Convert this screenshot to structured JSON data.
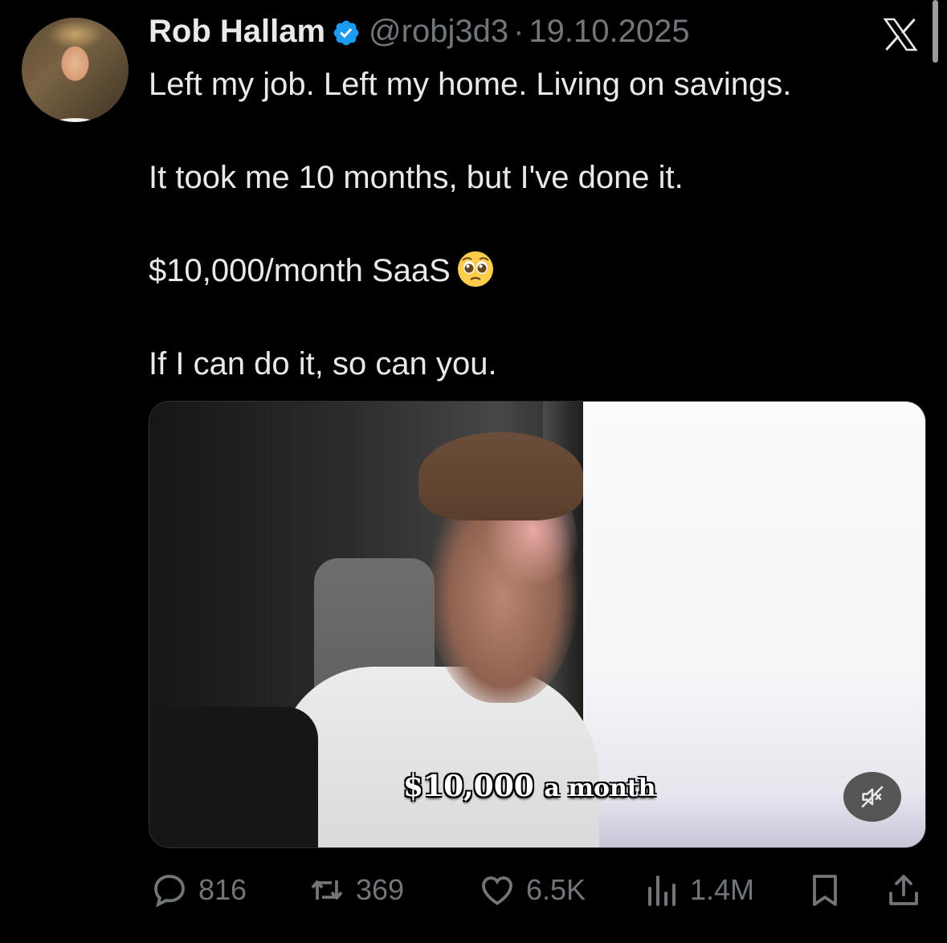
{
  "author": {
    "name": "Rob Hallam",
    "handle": "@robj3d3",
    "separator": "·",
    "date": "19.10.2025",
    "verified": true
  },
  "brand": {
    "logo_icon": "x-logo-icon"
  },
  "tweet": {
    "lines": [
      "Left my job. Left my home. Living on savings.",
      "It took me 10 months, but I've done it.",
      "$10,000/month SaaS",
      "If I can do it, so can you."
    ],
    "emoji": "pleading-face-emoji"
  },
  "media": {
    "type": "video",
    "caption_main": "$10,000",
    "caption_rest": "a month",
    "muted": true,
    "mute_icon": "speaker-muted-icon"
  },
  "actions": {
    "replies": "816",
    "reposts": "369",
    "likes": "6.5K",
    "views": "1.4M",
    "reply_icon": "speech-bubble-icon",
    "repost_icon": "repost-arrows-icon",
    "like_icon": "heart-icon",
    "views_icon": "bar-chart-icon",
    "bookmark_icon": "bookmark-icon",
    "share_icon": "share-upload-icon"
  },
  "colors": {
    "background": "#000000",
    "text_primary": "#e7e9ea",
    "text_secondary": "#71767b",
    "verified_blue": "#1d9bf0"
  }
}
